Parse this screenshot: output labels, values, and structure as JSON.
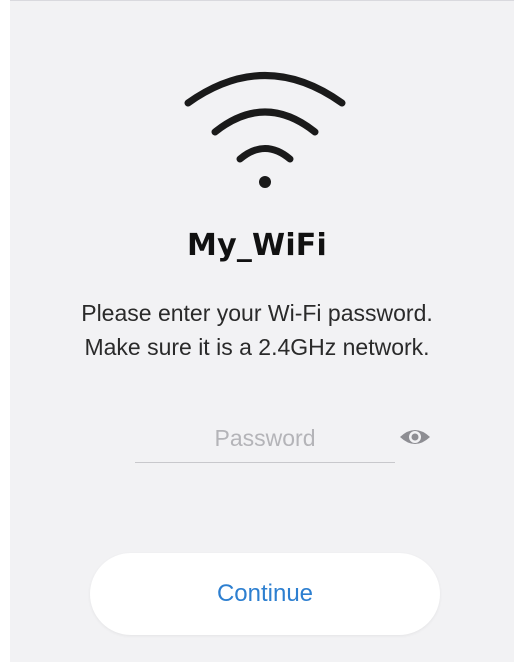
{
  "network": {
    "ssid": "My_WiFi",
    "icon": "wifi-icon"
  },
  "instructions": {
    "line1": "Please enter your Wi-Fi password.",
    "line2": "Make sure it is a 2.4GHz network."
  },
  "password": {
    "placeholder": "Password",
    "value": "",
    "toggle_icon": "eye-icon"
  },
  "actions": {
    "continue_label": "Continue"
  },
  "colors": {
    "background": "#f2f2f4",
    "accent": "#2d7fd0",
    "placeholder": "#b4b4b8",
    "icon": "#1a1a1a"
  }
}
